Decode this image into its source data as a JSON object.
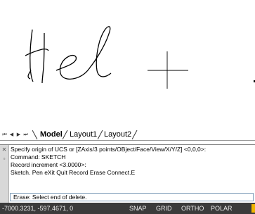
{
  "tabs": {
    "model": "Model",
    "layout1": "Layout1",
    "layout2": "Layout2"
  },
  "nav": {
    "first": "⏮",
    "prev": "◀",
    "next": "▶",
    "last": "⏭"
  },
  "command_history": [
    "Specify origin of UCS or [ZAxis/3 points/OBject/Face/View/X/Y/Z] <0,0,0>:",
    "Command: SKETCH",
    "Record increment <3.0000>:",
    "Sketch. Pen eXit Quit Record Erase Connect.E"
  ],
  "command_input": "Erase: Select end of delete.",
  "status_bar": {
    "coordinates": "-7000.3231, -597.4671, 0",
    "toggles": [
      "SNAP",
      "GRID",
      "ORTHO",
      "POLAR"
    ]
  },
  "colors": {
    "status_bg": "#3b3b3b",
    "status_accent": "#f0b400",
    "sketch_stroke": "#000000",
    "crosshair": "#000000"
  },
  "icons": {
    "rail_close": "close-icon",
    "rail_grip": "grip-icon"
  }
}
